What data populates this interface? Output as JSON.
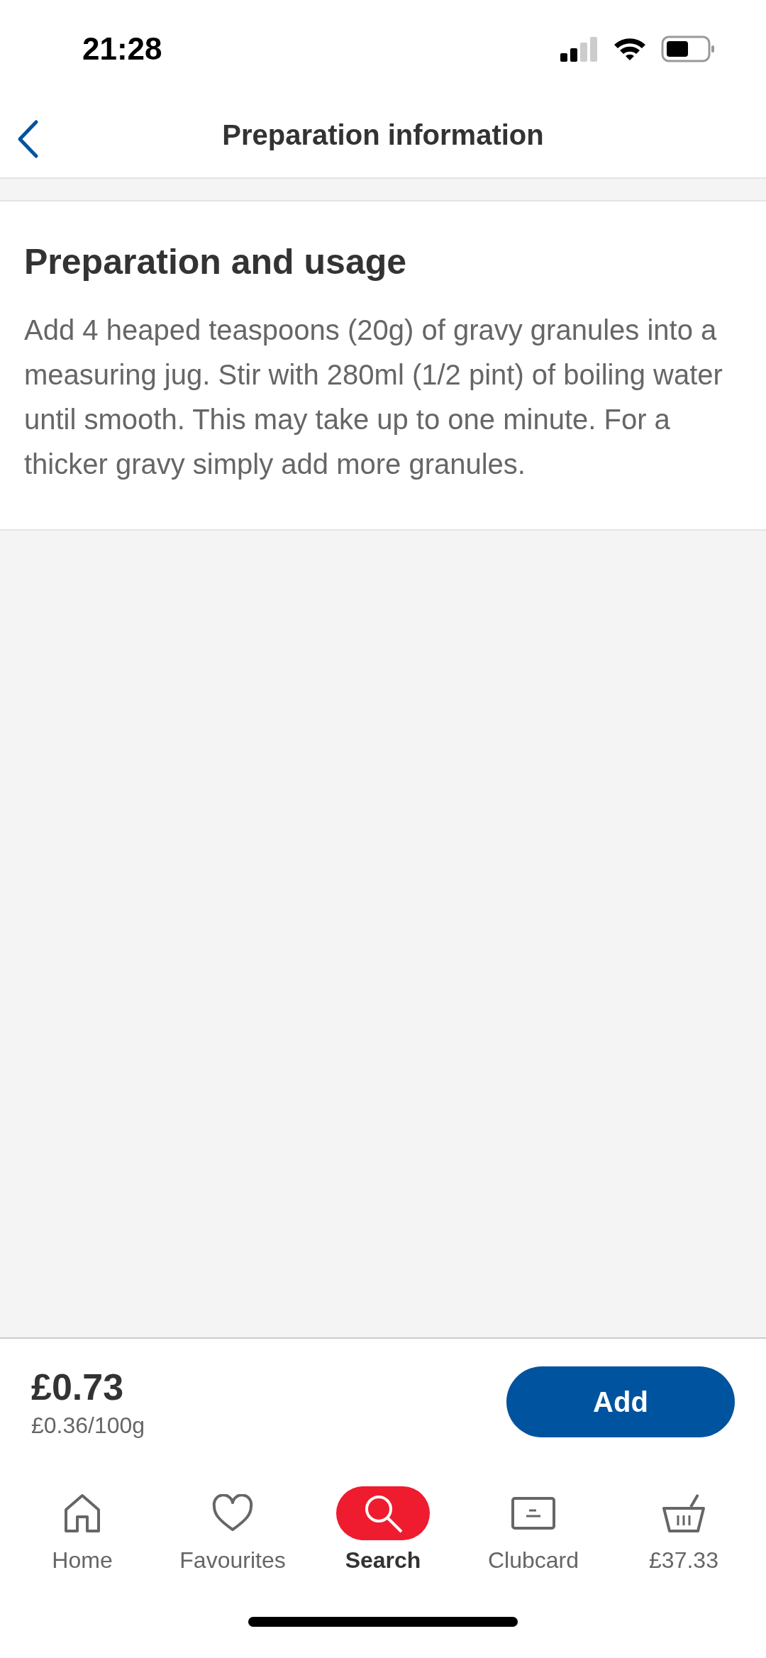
{
  "status_bar": {
    "time": "21:28"
  },
  "header": {
    "title": "Preparation information"
  },
  "section": {
    "heading": "Preparation and usage",
    "body": "Add 4 heaped teaspoons (20g) of gravy granules into a measuring jug. Stir with 280ml (1/2 pint) of boiling water until smooth. This may take up to one minute. For a thicker gravy simply add more granules."
  },
  "purchase_bar": {
    "price": "£0.73",
    "unit_price": "£0.36/100g",
    "button": "Add"
  },
  "tab_bar": [
    {
      "kind": "home",
      "label": "Home",
      "selected": false
    },
    {
      "kind": "favourites",
      "label": "Favourites",
      "selected": false
    },
    {
      "kind": "search",
      "label": "Search",
      "selected": true
    },
    {
      "kind": "clubcard",
      "label": "Clubcard",
      "selected": false
    },
    {
      "kind": "basket",
      "label": "£37.33",
      "selected": false
    }
  ]
}
